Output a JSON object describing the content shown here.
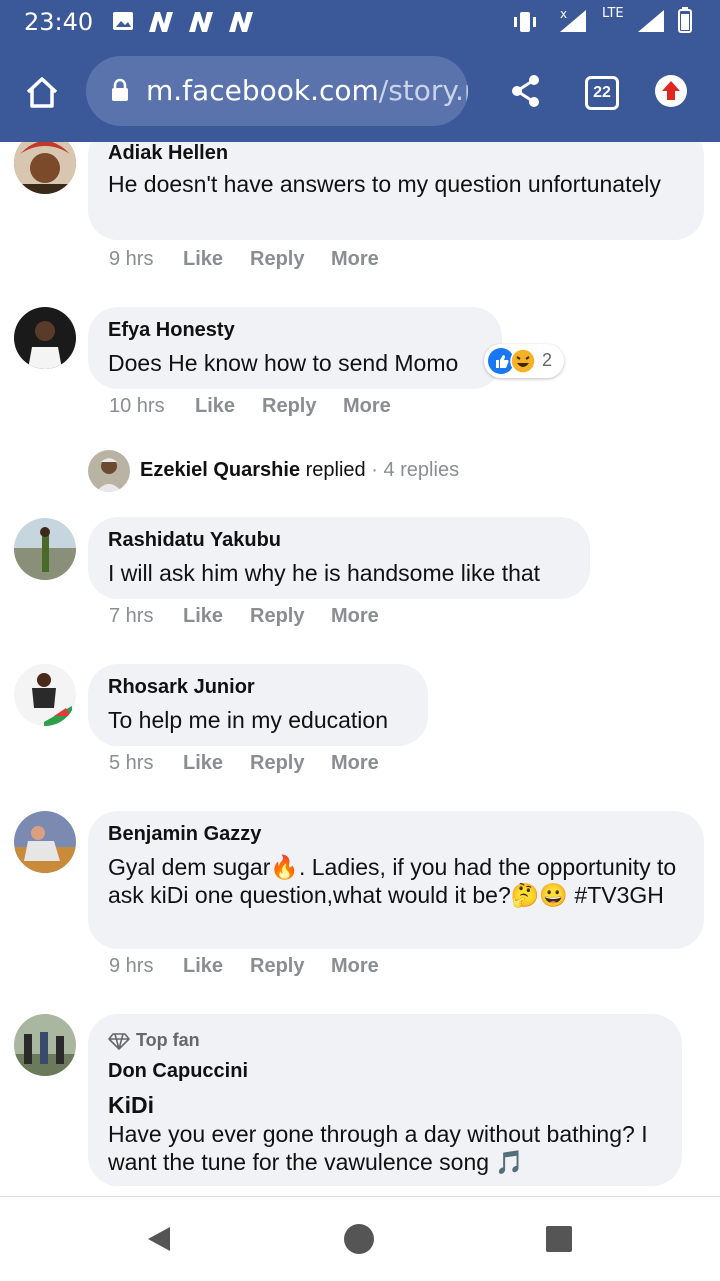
{
  "status_bar": {
    "time": "23:40",
    "notification_icons": [
      "image-icon",
      "n-icon",
      "n-icon",
      "n-icon"
    ],
    "network": "LTE"
  },
  "browser": {
    "url_host": "m.facebook.com",
    "url_path": "/story.p",
    "tab_count": "22"
  },
  "comments": [
    {
      "name": "Adiak Hellen",
      "text": "He doesn't have answers to my question unfortunately",
      "time": "9 hrs"
    },
    {
      "name": "Efya Honesty",
      "text": "Does He know how to send Momo",
      "time": "10 hrs",
      "reactions_count": "2"
    },
    {
      "name": "Rashidatu Yakubu",
      "text": "I will ask him why he is handsome like that",
      "time": "7 hrs"
    },
    {
      "name": "Rhosark Junior",
      "text": "To help me in my education",
      "time": "5 hrs"
    },
    {
      "name": "Benjamin Gazzy",
      "text": "Gyal dem sugar🔥. Ladies, if you had the opportunity to ask kiDi one question,what would it be?🤔😀 #TV3GH",
      "time": "9 hrs"
    },
    {
      "badge": "Top fan",
      "name": "Don Capuccini",
      "heading": "KiDi",
      "text": "Have you ever gone through a day without bathing? I want the tune for the vawulence song 🎵"
    }
  ],
  "actions": {
    "like": "Like",
    "reply": "Reply",
    "more": "More"
  },
  "reply_summary": {
    "name": "Ezekiel Quarshie",
    "replied": "replied",
    "count": "· 4 replies"
  },
  "colors": {
    "brand": "#3b5998",
    "bubble": "#f0f2f5",
    "meta": "#8a8d91"
  }
}
